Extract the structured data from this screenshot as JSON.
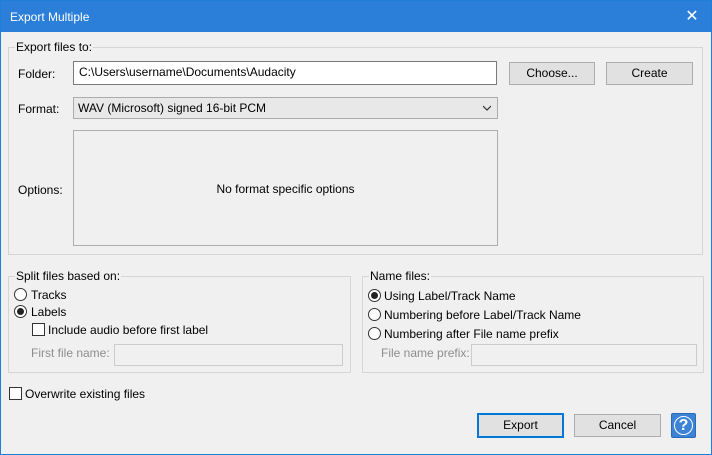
{
  "window": {
    "title": "Export Multiple",
    "close_glyph": "✕"
  },
  "export_files": {
    "legend": "Export files to:",
    "folder_label": "Folder:",
    "folder_value": "C:\\Users\\username\\Documents\\Audacity",
    "choose_label": "Choose...",
    "create_label": "Create",
    "format_label": "Format:",
    "format_value": "WAV (Microsoft) signed 16-bit PCM",
    "options_label": "Options:",
    "options_message": "No format specific options"
  },
  "split": {
    "legend": "Split files based on:",
    "tracks_label": "Tracks",
    "tracks_selected": false,
    "labels_label": "Labels",
    "labels_selected": true,
    "include_audio_label": "Include audio before first label",
    "include_audio_checked": false,
    "first_file_name_label": "First file name:",
    "first_file_name_value": ""
  },
  "name_files": {
    "legend": "Name files:",
    "opt_using_label": "Using Label/Track Name",
    "opt_before_label": "Numbering before Label/Track Name",
    "opt_after_label": "Numbering after File name prefix",
    "selected": "Using Label/Track Name",
    "prefix_label": "File name prefix:",
    "prefix_value": ""
  },
  "overwrite": {
    "label": "Overwrite existing files",
    "checked": false
  },
  "buttons": {
    "export_label": "Export",
    "cancel_label": "Cancel",
    "help_glyph": "?"
  },
  "colors": {
    "titlebar": "#2b7fd9",
    "accent": "#0078d7"
  }
}
